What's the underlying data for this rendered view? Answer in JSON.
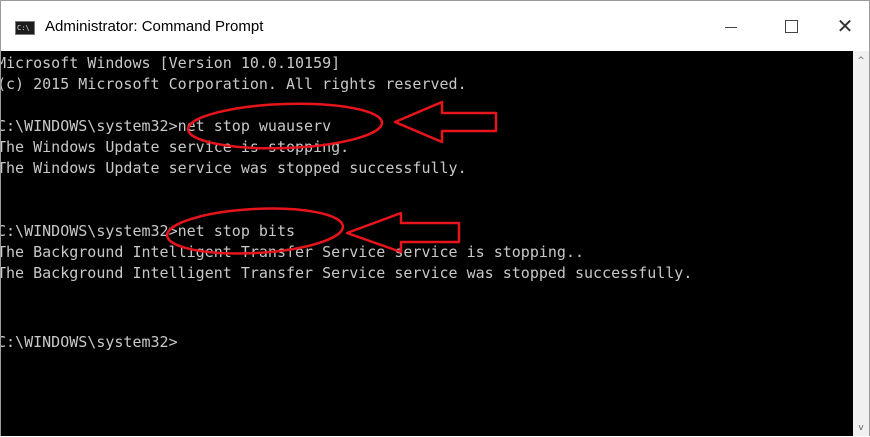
{
  "window": {
    "title": "Administrator: Command Prompt",
    "app_icon_text": "C:\\",
    "minimize_icon": "minimize-icon",
    "maximize_icon": "maximize-icon",
    "close_glyph": "✕"
  },
  "console": {
    "lines": [
      "Microsoft Windows [Version 10.0.10159]",
      "(c) 2015 Microsoft Corporation. All rights reserved.",
      "",
      "C:\\WINDOWS\\system32>net stop wuauserv",
      "The Windows Update service is stopping.",
      "The Windows Update service was stopped successfully.",
      "",
      "",
      "C:\\WINDOWS\\system32>net stop bits",
      "The Background Intelligent Transfer Service service is stopping..",
      "The Background Intelligent Transfer Service service was stopped successfully.",
      "",
      "",
      "",
      "C:\\WINDOWS\\system32>"
    ]
  },
  "annotations": {
    "color": "#e8141b"
  },
  "scrollbar": {
    "up_glyph": "^",
    "down_glyph": "v"
  }
}
